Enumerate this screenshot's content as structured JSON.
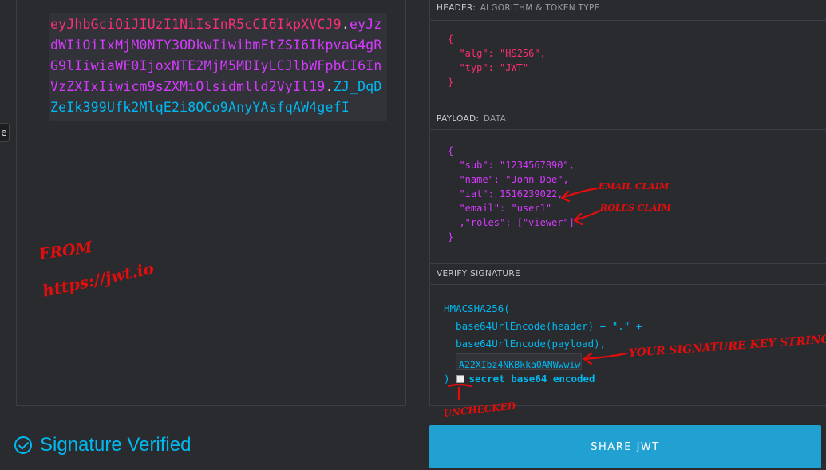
{
  "encoded": {
    "header_part": "eyJhbGciOiJIUzI1NiIsInR5cCI6IkpXVCJ9",
    "payload_part": "eyJzdWIiOiIxMjM0NTY3ODkwIiwibmFtZSI6IkpvaG4gRG9lIiwiaWF0IjoxNTE2MjM5MDIyLCJlbWFpbCI6InVzZXIxIiwicm9sZXMiOlsidmlld2VyIl19",
    "signature_part": "ZJ_DqDZeIk399Ufk2MlqE2i8OCo9AnyYAsfqAW4gefI",
    "dot": ".",
    "side_tab": "e"
  },
  "header": {
    "section_label": "HEADER:",
    "section_sub": "ALGORITHM & TOKEN TYPE",
    "lines": [
      "{",
      "  \"alg\": \"HS256\",",
      "  \"typ\": \"JWT\"",
      "}"
    ]
  },
  "payload": {
    "section_label": "PAYLOAD:",
    "section_sub": "DATA",
    "lines": [
      "{",
      "  \"sub\": \"1234567890\",",
      "  \"name\": \"John Doe\",",
      "  \"iat\": 1516239022,",
      "  \"email\": \"user1\"",
      "  ,\"roles\": [\"viewer\"]",
      "}"
    ]
  },
  "verify": {
    "section_label": "VERIFY SIGNATURE",
    "line1": "HMACSHA256(",
    "line2": "  base64UrlEncode(header) + \".\" +",
    "line3": "  base64UrlEncode(payload),",
    "secret_value": "A22XIbz4NKBkka0ANWwwiw",
    "close": ")",
    "checkbox_label": "secret base64 encoded",
    "checkbox_checked": false
  },
  "status": {
    "text": "Signature Verified"
  },
  "share_button": "SHARE JWT",
  "annotations": {
    "from": "FROM",
    "url": "https://jwt.io",
    "email_claim": "EMAIL CLAIM",
    "roles_claim": "ROLES CLAIM",
    "signature_key": "YOUR SIGNATURE KEY STRING",
    "unchecked": "UNCHECKED"
  },
  "colors": {
    "header": "#fb2f72",
    "payload": "#d63aff",
    "signature": "#00b9f1",
    "annotation": "#e30d0d",
    "button": "#21a0d2"
  }
}
